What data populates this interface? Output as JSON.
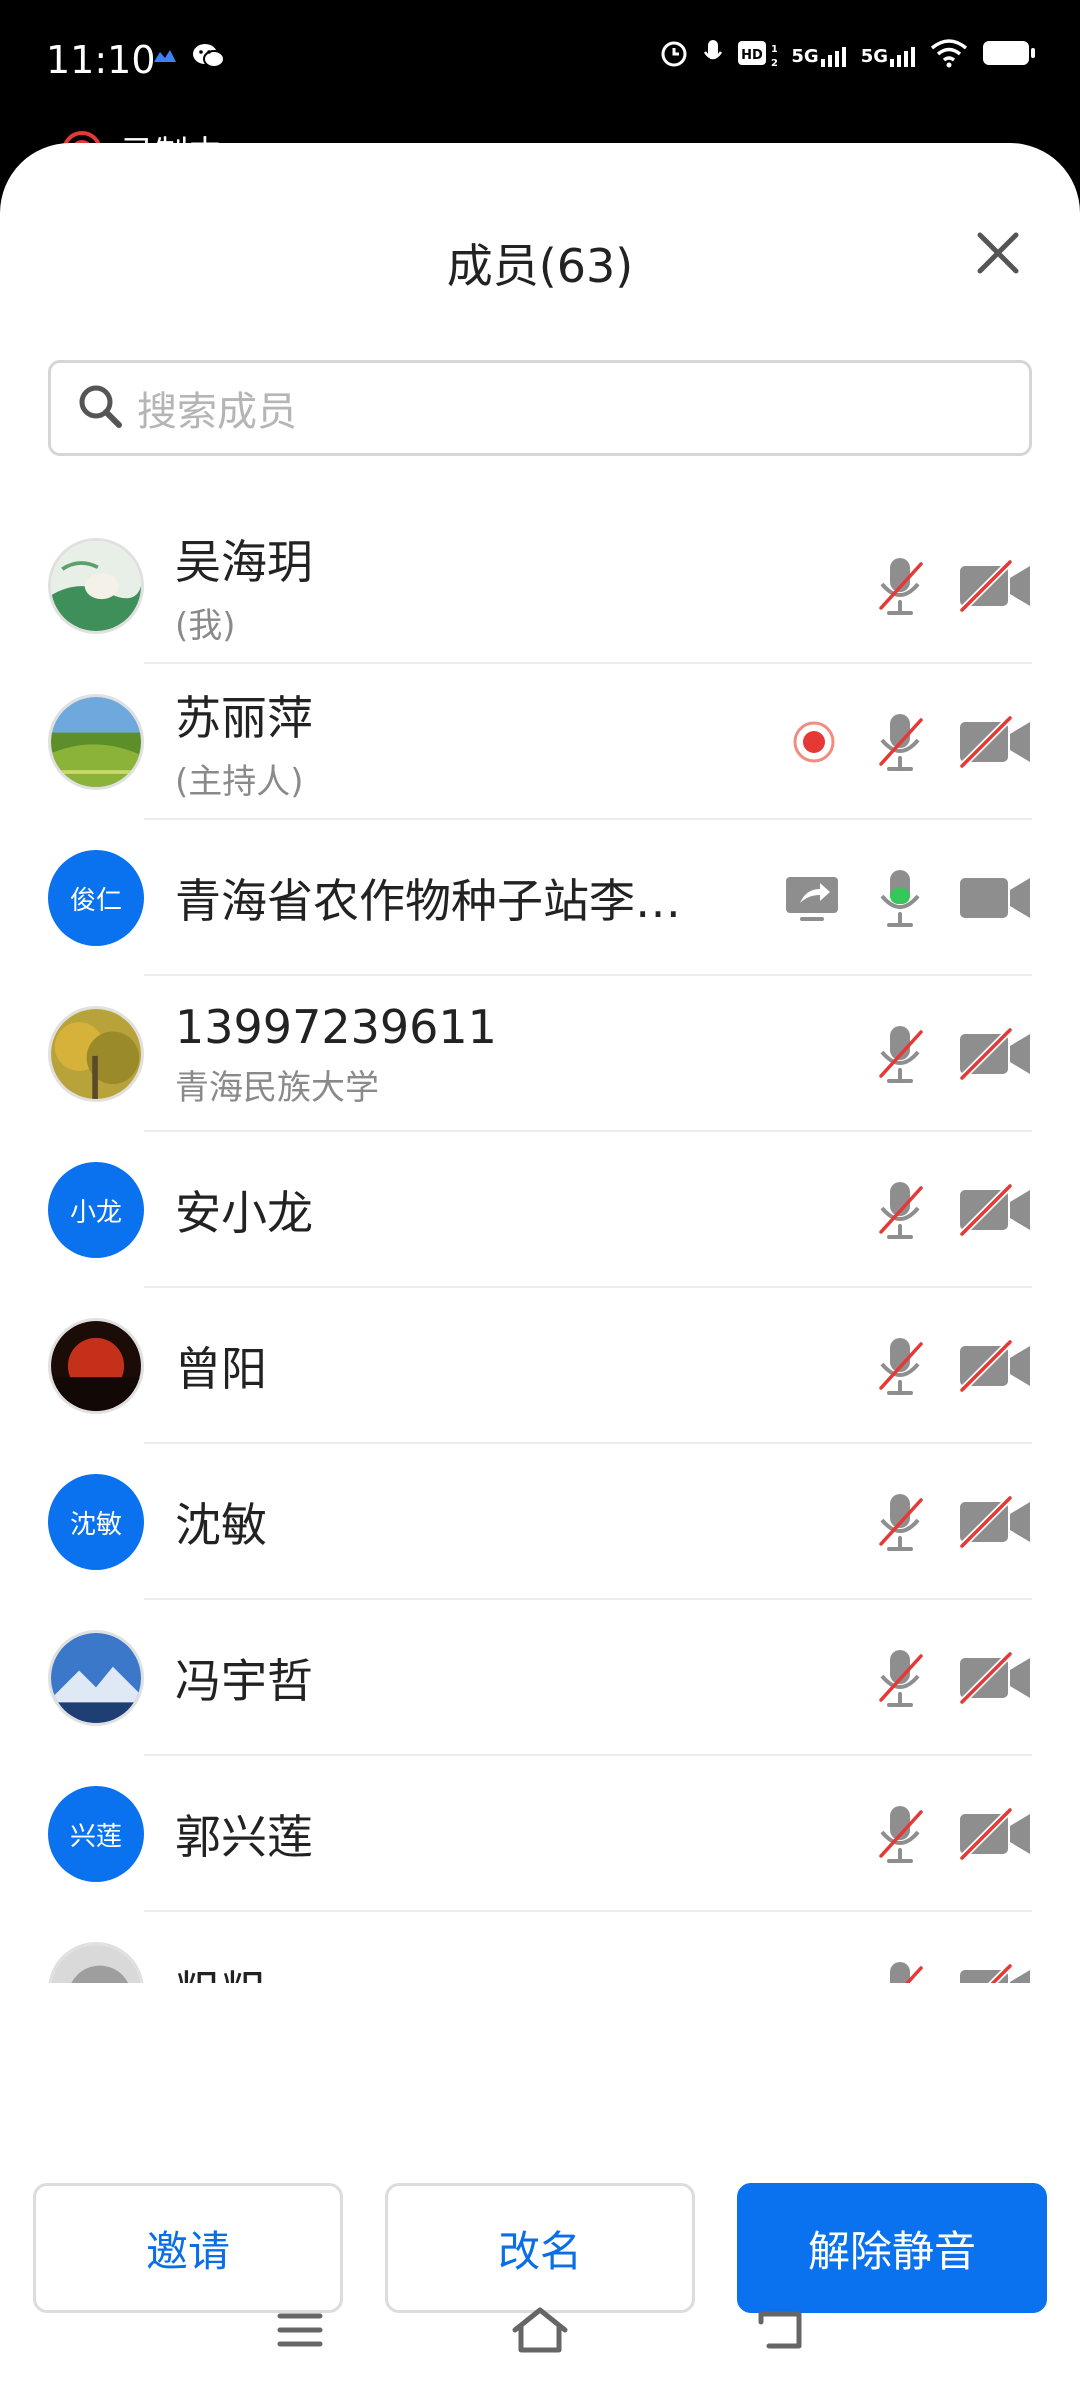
{
  "status": {
    "time": "11:10",
    "network1": "5G",
    "network2": "5G"
  },
  "recording_peek": "录制中",
  "sheet": {
    "title": "成员(63)",
    "search_placeholder": "搜索成员"
  },
  "members": [
    {
      "name": "吴海玥",
      "sub": "(我)",
      "avatar": "photo-scroll",
      "mic": "muted",
      "camera": "off"
    },
    {
      "name": "苏丽萍",
      "sub": "(主持人)",
      "avatar": "photo-landscape",
      "recording": true,
      "mic": "muted",
      "camera": "off"
    },
    {
      "name": "青海省农作物种子站李…",
      "avatar_text": "俊仁",
      "screen_share": true,
      "mic": "active",
      "camera": "on"
    },
    {
      "name": "13997239611",
      "sub": "青海民族大学",
      "avatar": "photo-autumn",
      "mic": "muted",
      "camera": "off"
    },
    {
      "name": "安小龙",
      "avatar_text": "小龙",
      "mic": "muted",
      "camera": "off"
    },
    {
      "name": "曾阳",
      "avatar": "photo-sunset",
      "mic": "muted",
      "camera": "off"
    },
    {
      "name": "沈敏",
      "avatar_text": "沈敏",
      "mic": "muted",
      "camera": "off"
    },
    {
      "name": "冯宇哲",
      "avatar": "photo-mountain",
      "mic": "muted",
      "camera": "off"
    },
    {
      "name": "郭兴莲",
      "avatar_text": "兴莲",
      "mic": "muted",
      "camera": "off"
    },
    {
      "name": "粗粗",
      "avatar": "photo-grey",
      "mic": "muted",
      "camera": "off"
    }
  ],
  "actions": {
    "invite": "邀请",
    "rename": "改名",
    "unmute": "解除静音"
  },
  "colors": {
    "accent": "#0a72ee",
    "muted_slash": "#e53935",
    "icon_grey": "#8e8e8e",
    "mic_active": "#34c759"
  }
}
